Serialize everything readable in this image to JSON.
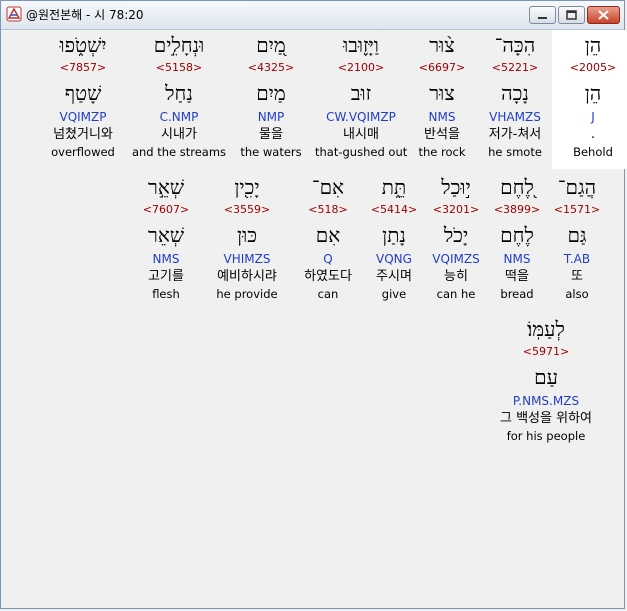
{
  "window": {
    "title": "@원전본해 - 시 78:20",
    "icons": [
      "app-icon",
      "minimize-icon",
      "maximize-icon",
      "close-icon"
    ]
  },
  "colors": {
    "strong": "#a00000",
    "grammar": "#1f3ec8",
    "selected_bg": "#ffffff"
  },
  "words": [
    {
      "hebrew": "הֵן",
      "strong": "<2005>",
      "lemma": "הֵן",
      "grammar": "J",
      "korean": ".",
      "english": "Behold",
      "selected": true
    },
    {
      "hebrew": "הִכָּה־",
      "strong": "<5221>",
      "lemma": "נָכָה",
      "grammar": "VHAMZS",
      "korean": "저가-쳐서",
      "english": "he smote",
      "selected": false
    },
    {
      "hebrew": "צ֨וּר",
      "strong": "<6697>",
      "lemma": "צוּר",
      "grammar": "NMS",
      "korean": "반석을",
      "english": "the rock",
      "selected": false
    },
    {
      "hebrew": "וַיָּז֪וּבוּ",
      "strong": "<2100>",
      "lemma": "זוּב",
      "grammar": "CW.VQIMZP",
      "korean": "내시매",
      "english": "that-gushed out",
      "selected": false
    },
    {
      "hebrew": "מַ֭יִם",
      "strong": "<4325>",
      "lemma": "מַיִם",
      "grammar": "NMP",
      "korean": "물을",
      "english": "the waters",
      "selected": false
    },
    {
      "hebrew": "וּנְחָלִ֣ים",
      "strong": "<5158>",
      "lemma": "נַחַל",
      "grammar": "C.NMP",
      "korean": "시내가",
      "english": "and the streams",
      "selected": false
    },
    {
      "hebrew": "יִשְׁטֹ֑פוּ",
      "strong": "<7857>",
      "lemma": "שָׁטַף",
      "grammar": "VQIMZP",
      "korean": "넘쳤거니와",
      "english": "overflowed",
      "selected": false
    },
    {
      "hebrew": "הֲגַם־",
      "strong": "<1571>",
      "lemma": "גַּם",
      "grammar": "T.AB",
      "korean": "또",
      "english": "also",
      "selected": false
    },
    {
      "hebrew": "לֶ֭חֶם",
      "strong": "<3899>",
      "lemma": "לֶחֶם",
      "grammar": "NMS",
      "korean": "떡을",
      "english": "bread",
      "selected": false
    },
    {
      "hebrew": "י֣וּכַל",
      "strong": "<3201>",
      "lemma": "יָכֹל",
      "grammar": "VQIMZS",
      "korean": "능히",
      "english": "can he",
      "selected": false
    },
    {
      "hebrew": "תֵּ֑ת",
      "strong": "<5414>",
      "lemma": "נָתַן",
      "grammar": "VQNG",
      "korean": "주시며",
      "english": "give",
      "selected": false
    },
    {
      "hebrew": "אִם־",
      "strong": "<518>",
      "lemma": "אִם",
      "grammar": "Q",
      "korean": "하였도다",
      "english": "can",
      "selected": false
    },
    {
      "hebrew": "יָכִ֖ין",
      "strong": "<3559>",
      "lemma": "כּוּן",
      "grammar": "VHIMZS",
      "korean": "예비하시랴",
      "english": "he provide",
      "selected": false
    },
    {
      "hebrew": "שְׁאֵ֣ר",
      "strong": "<7607>",
      "lemma": "שְׁאֵר",
      "grammar": "NMS",
      "korean": "고기를",
      "english": "flesh",
      "selected": false
    },
    {
      "hebrew": "לְעַמּֽוֹ׃",
      "strong": "<5971>",
      "lemma": "עַם",
      "grammar": "P.NMS.MZS",
      "korean": "그 백성을 위하여",
      "english": "for his people",
      "selected": false
    }
  ]
}
